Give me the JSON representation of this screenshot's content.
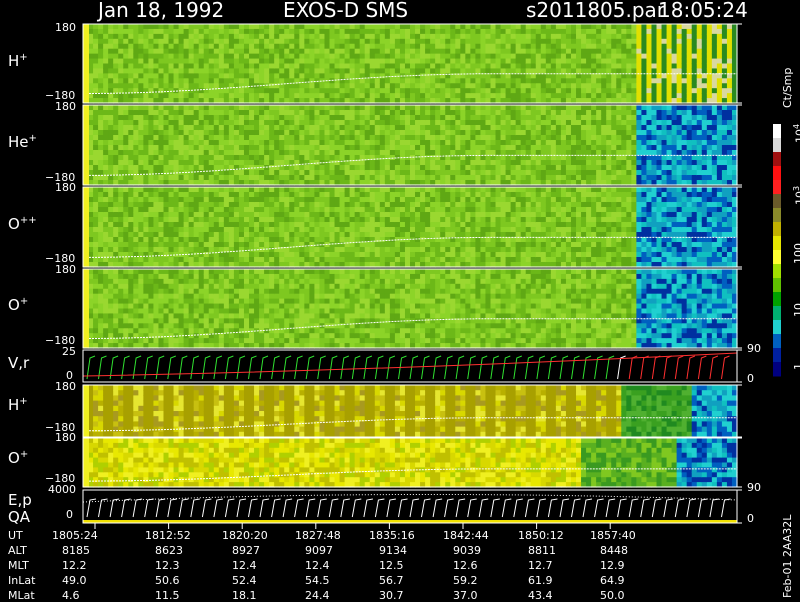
{
  "header": {
    "date": "Jan 18, 1992",
    "instrument": "EXOS-D SMS",
    "file": "s2011805.par",
    "time": "18:05:24"
  },
  "panels": [
    {
      "id": "h1",
      "label": "H",
      "charge": "+",
      "ytop": "180",
      "ybot": "−180",
      "type": "spectrogram",
      "palette": "hplus"
    },
    {
      "id": "he",
      "label": "He",
      "charge": "+",
      "ytop": "180",
      "ybot": "−180",
      "type": "spectrogram",
      "palette": "heplus"
    },
    {
      "id": "opp",
      "label": "O",
      "charge": "++",
      "ytop": "180",
      "ybot": "−180",
      "type": "spectrogram",
      "palette": "oplusplus"
    },
    {
      "id": "op1",
      "label": "O",
      "charge": "+",
      "ytop": "180",
      "ybot": "−180",
      "type": "spectrogram",
      "palette": "oplus"
    },
    {
      "id": "vr",
      "label": "V,r",
      "charge": "",
      "ytop": "25",
      "ybot": "0",
      "right_top": "90",
      "right_bot": "0",
      "type": "line"
    },
    {
      "id": "h2",
      "label": "H",
      "charge": "+",
      "ytop": "180",
      "ybot": "−180",
      "type": "spectrogram",
      "palette": "hstripe"
    },
    {
      "id": "op2",
      "label": "O",
      "charge": "+",
      "ytop": "180",
      "ybot": "−180",
      "type": "spectrogram",
      "palette": "oyellow"
    },
    {
      "id": "ep",
      "label": "E,p",
      "label2": "QA",
      "charge": "",
      "ytop": "4000",
      "ybot": "0",
      "right_top": "90",
      "right_bot": "0",
      "type": "line"
    }
  ],
  "colorbar": {
    "unit": "Ct/Smp",
    "ticks": [
      {
        "base": "10",
        "exp": "4"
      },
      {
        "base": "10",
        "exp": "3"
      },
      {
        "base": "100",
        "exp": ""
      },
      {
        "base": "10",
        "exp": ""
      },
      {
        "base": "1",
        "exp": ""
      }
    ],
    "colors": [
      "#ffffff",
      "#d8d8d8",
      "#a01010",
      "#ff1010",
      "#ff2020",
      "#6a5a2a",
      "#8a8a2a",
      "#c0b000",
      "#e6e600",
      "#ffff30",
      "#a0e000",
      "#60c000",
      "#00a000",
      "#00b070",
      "#20d0d0",
      "#0060c0",
      "#0020a0",
      "#000080"
    ]
  },
  "table": {
    "rows": [
      {
        "label": "UT",
        "values": [
          "1805:24",
          "1812:52",
          "1820:20",
          "1827:48",
          "1835:16",
          "1842:44",
          "1850:12",
          "1857:40"
        ]
      },
      {
        "label": "ALT",
        "values": [
          "8185",
          "8623",
          "8927",
          "9097",
          "9134",
          "9039",
          "8811",
          "8448"
        ]
      },
      {
        "label": "MLT",
        "values": [
          "12.2",
          "12.3",
          "12.4",
          "12.4",
          "12.5",
          "12.6",
          "12.7",
          "12.9"
        ]
      },
      {
        "label": "InLat",
        "values": [
          "49.0",
          "50.6",
          "52.4",
          "54.5",
          "56.7",
          "59.2",
          "61.9",
          "64.9"
        ]
      },
      {
        "label": "MLat",
        "values": [
          "4.6",
          "11.5",
          "18.1",
          "24.4",
          "30.7",
          "37.0",
          "43.4",
          "50.0"
        ]
      }
    ]
  },
  "footer": "Feb-01 2AA32L",
  "chart_data": {
    "type": "heatmap",
    "title": "Jan 18, 1992   EXOS-D SMS",
    "x_labels": [
      "1805:24",
      "1812:52",
      "1820:20",
      "1827:48",
      "1835:16",
      "1842:44",
      "1850:12",
      "1857:40"
    ],
    "series": [
      {
        "name": "H+",
        "ylim": [
          -180,
          180
        ]
      },
      {
        "name": "He+",
        "ylim": [
          -180,
          180
        ]
      },
      {
        "name": "O++",
        "ylim": [
          -180,
          180
        ]
      },
      {
        "name": "O+",
        "ylim": [
          -180,
          180
        ]
      },
      {
        "name": "V,r",
        "ylim": [
          0,
          25
        ]
      },
      {
        "name": "H+",
        "ylim": [
          -180,
          180
        ]
      },
      {
        "name": "O+",
        "ylim": [
          -180,
          180
        ]
      },
      {
        "name": "E,p",
        "ylim": [
          0,
          4000
        ]
      }
    ],
    "colorbar_range": [
      1,
      10000
    ],
    "colorbar_scale": "log"
  }
}
